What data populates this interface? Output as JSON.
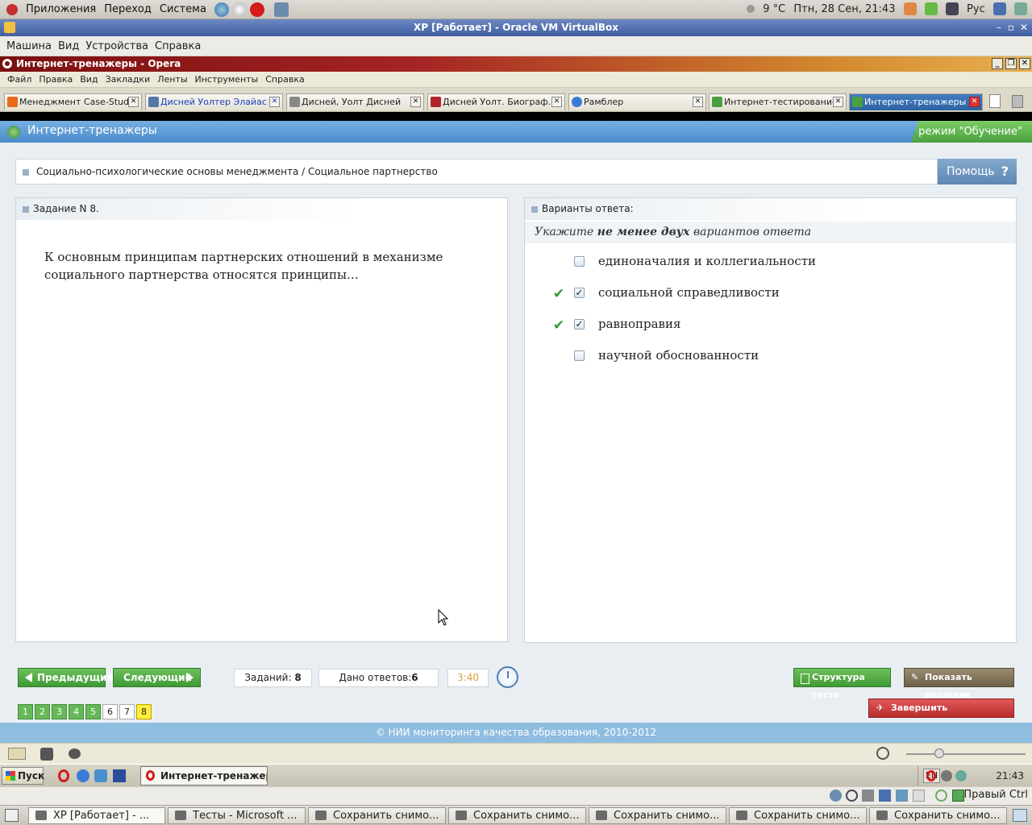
{
  "gnome_top": {
    "menus": [
      "Приложения",
      "Переход",
      "Система"
    ],
    "weather": "9 °C",
    "datetime": "Птн, 28 Сен, 21:43",
    "layout": "Рус"
  },
  "vbox": {
    "title": "XP [Работает] - Oracle VM VirtualBox",
    "menus": [
      "Машина",
      "Вид",
      "Устройства",
      "Справка"
    ],
    "host_key": "Правый Ctrl"
  },
  "opera": {
    "title": "Интернет-тренажеры - Opera",
    "menus": [
      "Файл",
      "Правка",
      "Вид",
      "Закладки",
      "Ленты",
      "Инструменты",
      "Справка"
    ],
    "tabs": [
      {
        "label": "Менеджмент Case-Stud...",
        "color": "#e86a1a"
      },
      {
        "label": "Дисней Уолтер Элайас",
        "color": "#5577aa"
      },
      {
        "label": "Дисней, Уолт Дисней",
        "color": "#888888"
      },
      {
        "label": "Дисней Уолт. Биограф...",
        "color": "#b3232a"
      },
      {
        "label": "Рамблер",
        "color": "#3a7bd5"
      },
      {
        "label": "Интернет-тестирование",
        "color": "#4aa040"
      },
      {
        "label": "Интернет-тренажеры",
        "color": "#4aa040"
      }
    ]
  },
  "page": {
    "header_title": "Интернет-тренажеры",
    "mode": "режим \"Обучение\"",
    "breadcrumb": "Социально-психологические основы менеджмента / Социальное партнерство",
    "help": "Помощь",
    "task_title": "Задание N 8.",
    "task_text": "К основным принципам партнерских отношений в механизме социального партнерства относятся принципы…",
    "answers_title": "Варианты ответа:",
    "instruction_pre": "Укажите",
    "instruction_bold": "не менее двух",
    "instruction_post": "вариантов ответа",
    "options": [
      {
        "label": "единоначалия и коллегиальности",
        "checked": false,
        "correct": false
      },
      {
        "label": "социальной справедливости",
        "checked": true,
        "correct": true
      },
      {
        "label": "равноправия",
        "checked": true,
        "correct": true
      },
      {
        "label": "научной обоснованности",
        "checked": false,
        "correct": false
      }
    ],
    "prev": "Предыдущий",
    "next": "Следующий",
    "tasks_label": "Заданий:",
    "tasks_count": "8",
    "answers_label": "Дано ответов:",
    "answers_count": "6",
    "timer": "3:40",
    "structure": "Структура теста",
    "show_solution": "Показать решение",
    "finish": "Завершить тестирование",
    "question_numbers": [
      "1",
      "2",
      "3",
      "4",
      "5",
      "6",
      "7",
      "8"
    ],
    "footer": "© НИИ мониторинга качества образования, 2010-2012"
  },
  "xp": {
    "start": "Пуск",
    "task": "Интернет-тренажер...",
    "lang": "EN",
    "time": "21:43"
  },
  "gnome_bottom": {
    "tasks": [
      "XP [Работает] - ...",
      "Тесты - Microsoft ...",
      "Сохранить снимо...",
      "Сохранить снимо...",
      "Сохранить снимо...",
      "Сохранить снимо...",
      "Сохранить снимо..."
    ]
  }
}
